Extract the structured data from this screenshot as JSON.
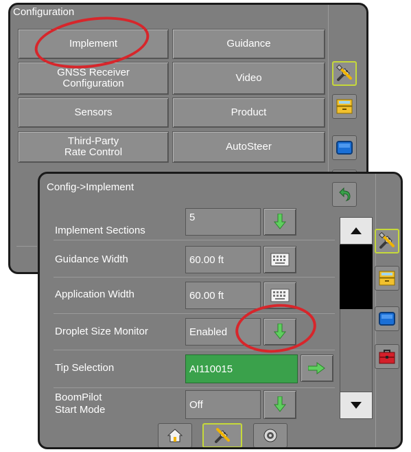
{
  "back_panel": {
    "title": "Configuration",
    "buttons": [
      {
        "label": "Implement"
      },
      {
        "label": "Guidance"
      },
      {
        "label": "GNSS Receiver\nConfiguration"
      },
      {
        "label": "Video"
      },
      {
        "label": "Sensors"
      },
      {
        "label": "Product"
      },
      {
        "label": "Third-Party\nRate Control"
      },
      {
        "label": "AutoSteer"
      }
    ],
    "side_icons": [
      "tools-icon",
      "drawer-icon",
      "monitor-icon"
    ]
  },
  "front_panel": {
    "title": "Config->Implement",
    "rows": [
      {
        "label": "Implement Sections",
        "value": "5",
        "action": "arrow-down-icon"
      },
      {
        "label": "Guidance Width",
        "value": "60.00 ft",
        "action": "keyboard-icon"
      },
      {
        "label": "Application Width",
        "value": "60.00 ft",
        "action": "keyboard-icon"
      },
      {
        "label": "Droplet Size Monitor",
        "value": "Enabled",
        "action": "arrow-down-icon"
      },
      {
        "label": "Tip Selection",
        "value": "AI110015",
        "action": "arrow-right-icon"
      },
      {
        "label": "BoomPilot\nStart Mode",
        "value": "Off",
        "action": "arrow-down-icon"
      }
    ],
    "side_icons": [
      "tools-icon",
      "drawer-icon",
      "monitor-icon",
      "toolbox-icon"
    ],
    "bottom_nav": [
      "home-icon",
      "tools-icon",
      "target-icon"
    ]
  },
  "colors": {
    "panel": "#7e7e7e",
    "highlight": "#c6d93a",
    "green_value": "#3aa14b",
    "annotation": "#d7262b"
  }
}
